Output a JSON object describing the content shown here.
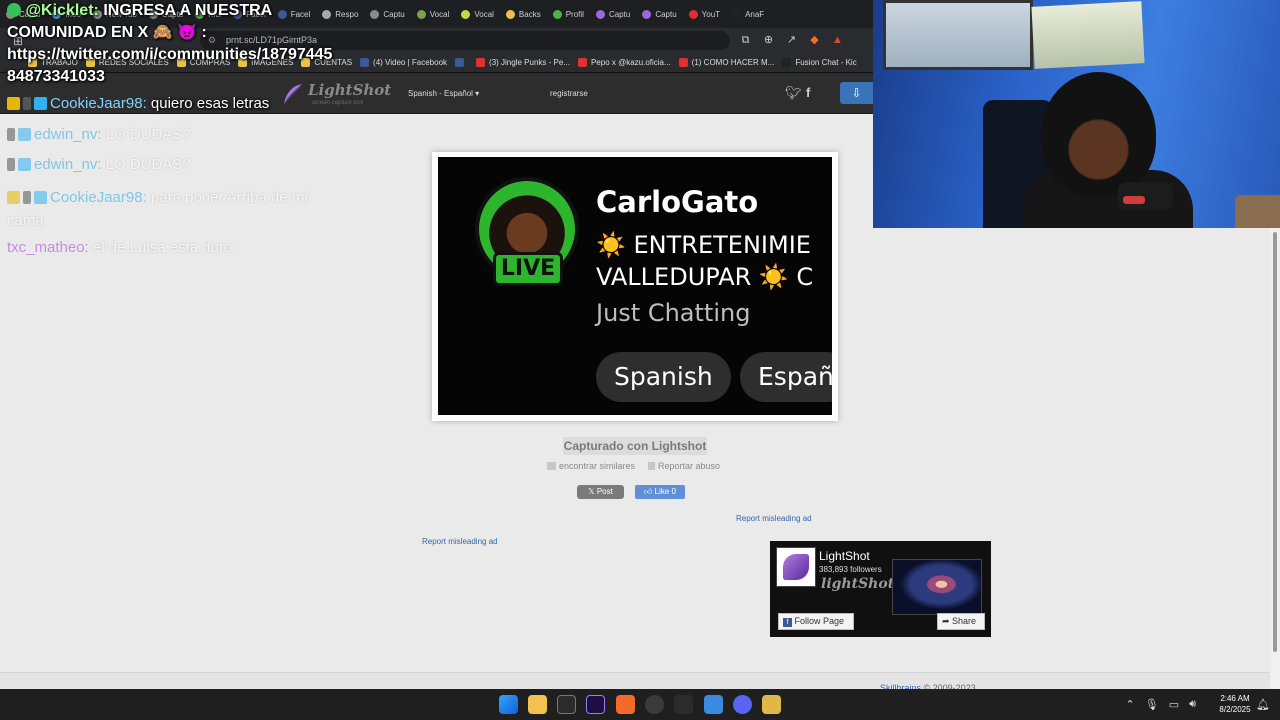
{
  "tabs": [
    {
      "label": "Captu",
      "color": "#8a8a8a"
    },
    {
      "label": "Moo",
      "color": "#5b8bd9"
    },
    {
      "label": "New Tab",
      "color": "#8a8a8a"
    },
    {
      "label": "Captu",
      "color": "#8a8a8a"
    },
    {
      "label": "Kicl",
      "color": "#4aa84a"
    },
    {
      "label": "Facel",
      "color": "#3b5998"
    },
    {
      "label": "Facel",
      "color": "#3b5998"
    },
    {
      "label": "Respo",
      "color": "#aaaaaa"
    },
    {
      "label": "Captu",
      "color": "#8a8a8a"
    },
    {
      "label": "Vocal",
      "color": "#7aa34a"
    },
    {
      "label": "Vocal",
      "color": "#c8d84a"
    },
    {
      "label": "Backs",
      "color": "#e6c24a"
    },
    {
      "label": "Profil",
      "color": "#4ab54a"
    },
    {
      "label": "Captu",
      "color": "#9a6ad8"
    },
    {
      "label": "Captu",
      "color": "#9a6ad8"
    },
    {
      "label": "YouT",
      "color": "#e03030"
    },
    {
      "label": "AnaF",
      "color": "#222222"
    }
  ],
  "address": {
    "url": "prnt.sc/LD71pGimtP3a"
  },
  "bookmarks": [
    {
      "label": "TRABAJO",
      "color": "#e8c24a"
    },
    {
      "label": "REDES SOCIALES",
      "color": "#e8c24a"
    },
    {
      "label": "COMPRAS",
      "color": "#e8c24a"
    },
    {
      "label": "IMÁGENES",
      "color": "#e8c24a"
    },
    {
      "label": "CUENTAS",
      "color": "#e8c24a"
    },
    {
      "label": "(4) Video | Facebook",
      "color": "#3b5998"
    },
    {
      "label": "",
      "color": "#3b5998"
    },
    {
      "label": "(3) Jingle Punks - Pe...",
      "color": "#e03030"
    },
    {
      "label": "Pepo x @kazu.oficia...",
      "color": "#e03030"
    },
    {
      "label": "(1) COMO HACER M...",
      "color": "#e03030"
    },
    {
      "label": "Fusion Chat - Kic",
      "color": "#222222"
    }
  ],
  "site_header": {
    "logo_text": "LightShot",
    "logo_sub": "screen capture tool",
    "language": "Spanish - Español",
    "register": "registrarse"
  },
  "screenshot": {
    "streamer": "CarloGato",
    "live": "LIVE",
    "title_line1": "☀️ ENTRETENIMIE",
    "title_line2": "VALLEDUPAR ☀️ C",
    "category": "Just Chatting",
    "tag1": "Spanish",
    "tag2": "Españ"
  },
  "page": {
    "captured_label": "Capturado con Lightshot",
    "find_similar": "encontrar similares",
    "report_abuse": "Reportar abuso",
    "tweet": "Post",
    "like": "Like 0",
    "report_ad_left": "Report misleading ad",
    "report_ad_right": "Report misleading ad",
    "footer_copy_link": "Skillbrains",
    "footer_copy": "© 2009-2023"
  },
  "fb_widget": {
    "name": "LightShot",
    "followers": "383,893 followers",
    "logo_text": "lightShot",
    "follow": "Follow Page",
    "share": "Share"
  },
  "chat": {
    "pinned_user": "@Kicklet:",
    "pinned_text": "INGRESA A NUESTRA COMUNIDAD EN X 🙈 👿 :",
    "pinned_link": "https://twitter.com/i/communities/1879744584873341033",
    "messages": [
      {
        "user": "CookieJaar98",
        "text": "quiero esas letras",
        "user_color": "#7fd3ff",
        "faded": false
      },
      {
        "user": "edwin_nv",
        "text": "LO DUDAS?",
        "user_color": "#7fd3ff",
        "faded": true
      },
      {
        "user": "edwin_nv",
        "text": "LO DUDAS?",
        "user_color": "#7fd3ff",
        "faded": true
      },
      {
        "user": "CookieJaar98",
        "text": "para poner Arriba de mi cama",
        "user_color": "#7fd3ff",
        "faded": true
      },
      {
        "user": "txc_matheo",
        "text": "el de Luisa esta duro",
        "user_color": "#c278e8",
        "faded": true
      }
    ]
  },
  "taskbar": {
    "time": "2:46 AM",
    "date": "8/2/2025"
  }
}
